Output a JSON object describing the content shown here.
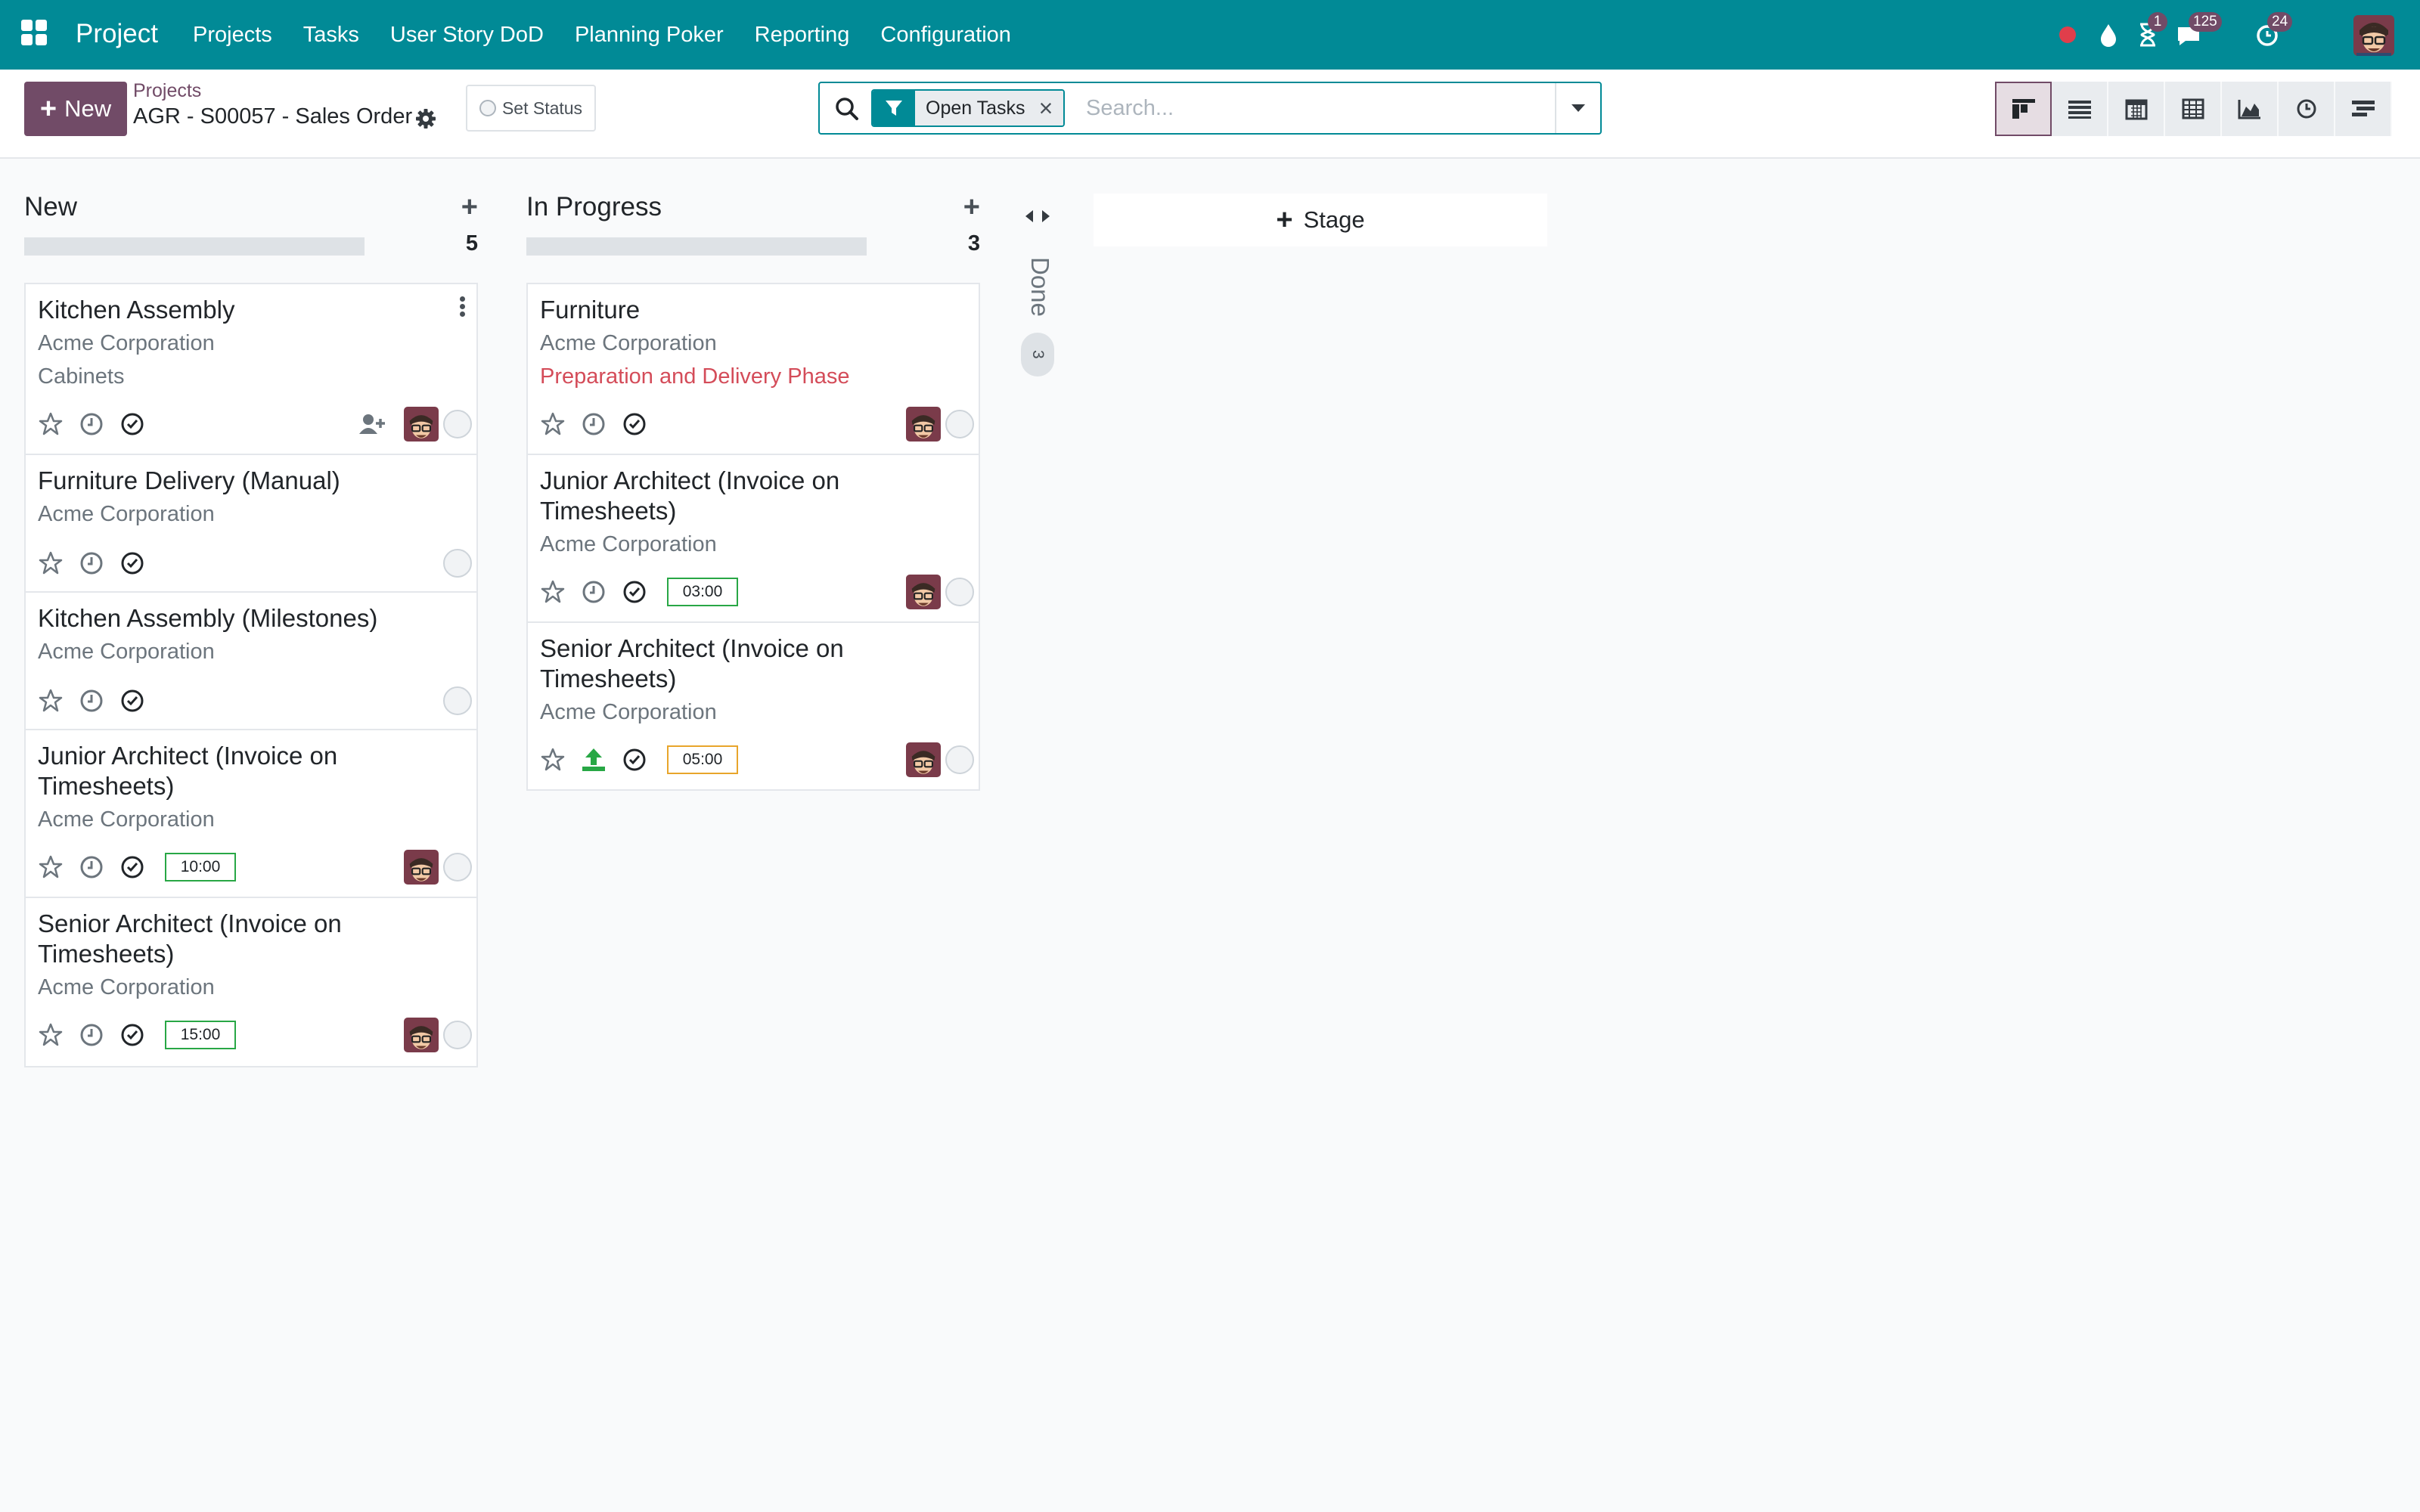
{
  "navbar": {
    "app_name": "Project",
    "menu": [
      "Projects",
      "Tasks",
      "User Story DoD",
      "Planning Poker",
      "Reporting",
      "Configuration"
    ],
    "badges": {
      "activities": "1",
      "messages": "125",
      "updates": "24"
    },
    "brand_color": "#018a96"
  },
  "control_panel": {
    "new_label": "New",
    "breadcrumb_parent": "Projects",
    "breadcrumb_current": "AGR - S00057 - Sales Order",
    "set_status_label": "Set Status",
    "search": {
      "facet": "Open Tasks",
      "placeholder": "Search..."
    },
    "views": [
      "kanban",
      "list",
      "calendar",
      "pivot",
      "graph",
      "activity",
      "gantt"
    ],
    "active_view": "kanban",
    "accent_color": "#714b67"
  },
  "columns": [
    {
      "title": "New",
      "count": "5",
      "cards": [
        {
          "title": "Kitchen Assembly",
          "partner": "Acme Corporation",
          "tag": "Cabinets",
          "hours": ""
        },
        {
          "title": "Furniture Delivery (Manual)",
          "partner": "Acme Corporation",
          "tag": "",
          "hours": ""
        },
        {
          "title": "Kitchen Assembly (Milestones)",
          "partner": "Acme Corporation",
          "tag": "",
          "hours": ""
        },
        {
          "title": "Junior Architect (Invoice on Timesheets)",
          "partner": "Acme Corporation",
          "tag": "",
          "hours": "10:00"
        },
        {
          "title": "Senior Architect (Invoice on Timesheets)",
          "partner": "Acme Corporation",
          "tag": "",
          "hours": "15:00"
        }
      ]
    },
    {
      "title": "In Progress",
      "count": "3",
      "cards": [
        {
          "title": "Furniture",
          "partner": "Acme Corporation",
          "tag": "Preparation and Delivery Phase",
          "hours": ""
        },
        {
          "title": "Junior Architect (Invoice on Timesheets)",
          "partner": "Acme Corporation",
          "tag": "",
          "hours": "03:00"
        },
        {
          "title": "Senior Architect (Invoice on Timesheets)",
          "partner": "Acme Corporation",
          "tag": "",
          "hours": "05:00"
        }
      ]
    }
  ],
  "folded_column": {
    "title": "Done",
    "count": "3"
  },
  "add_stage_label": "Stage"
}
